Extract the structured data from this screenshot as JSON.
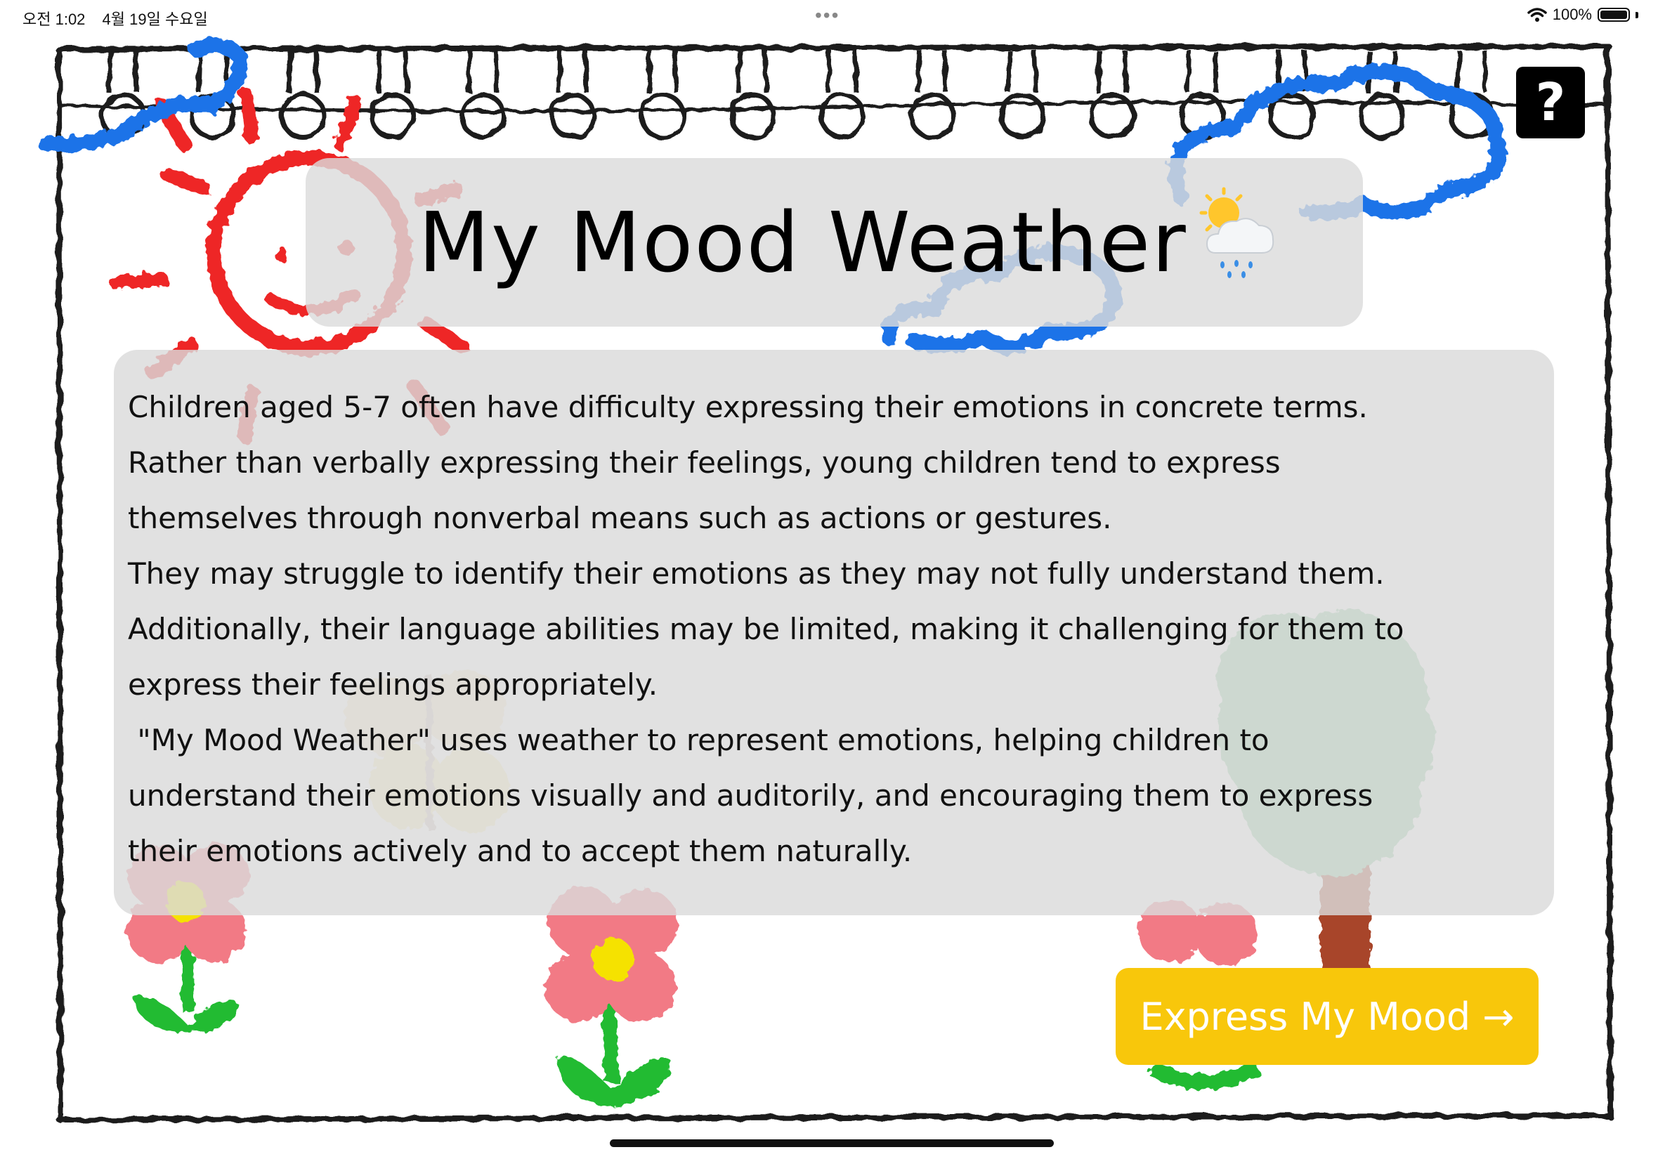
{
  "status_bar": {
    "time": "오전 1:02",
    "date": "4월 19일 수요일",
    "multitask_dots": "•••",
    "battery": "100%"
  },
  "title": {
    "text": "My Mood Weather",
    "icon": "sun-behind-rain-cloud-icon"
  },
  "description": {
    "lines": [
      "Children aged 5-7 often have difficulty expressing their emotions in concrete terms.",
      "Rather than verbally expressing their feelings, young children tend to express",
      "themselves through nonverbal means such as actions or gestures.",
      "They may struggle to identify their emotions as they may not fully understand them.",
      "Additionally, their language abilities may be limited, making it challenging for them to",
      "express their feelings appropriately.",
      " \"My Mood Weather\" uses weather to represent emotions, helping children to",
      "understand their emotions visually and auditorily, and encouraging them to express",
      "their emotions actively and to accept them naturally."
    ]
  },
  "help_button": {
    "label": "?"
  },
  "cta_button": {
    "label": "Express My Mood →"
  },
  "colors": {
    "cta": "#f8c70b",
    "sun": "#ee2525",
    "cloud": "#1e73e8",
    "flower_petal": "#f27a85",
    "flower_center": "#f5e200",
    "stem": "#22bb33",
    "tree": "#8fcca0",
    "trunk": "#a8452a"
  }
}
